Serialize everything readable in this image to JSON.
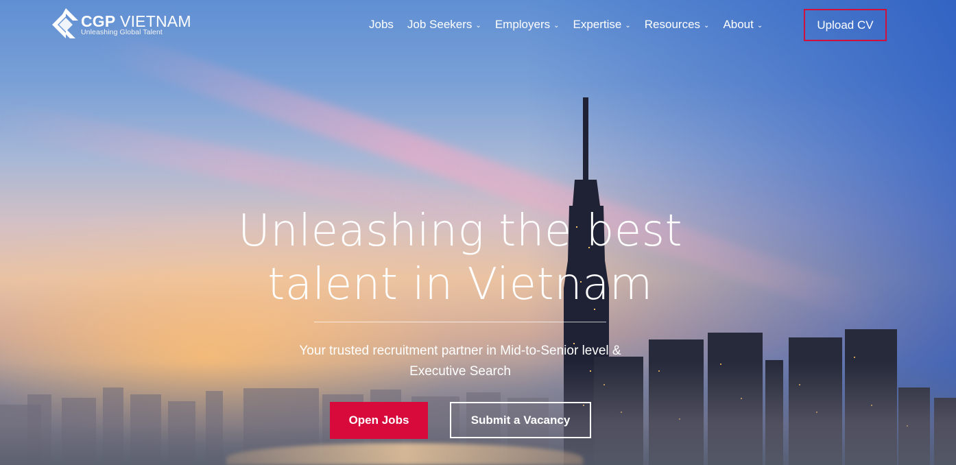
{
  "brand": {
    "name_bold": "CGP",
    "name_light": " VIETNAM",
    "tagline": "Unleashing Global Talent",
    "logo_icon": "diamond-arrow-logo"
  },
  "nav": {
    "items": [
      {
        "label": "Jobs",
        "has_dropdown": false
      },
      {
        "label": "Job Seekers",
        "has_dropdown": true
      },
      {
        "label": "Employers",
        "has_dropdown": true
      },
      {
        "label": "Expertise",
        "has_dropdown": true
      },
      {
        "label": "Resources",
        "has_dropdown": true
      },
      {
        "label": "About",
        "has_dropdown": true
      }
    ],
    "dropdown_glyph": "⌄",
    "upload_cv": "Upload CV"
  },
  "hero": {
    "headline_line1": "Unleashing the best",
    "headline_line2": "talent in Vietnam",
    "subtitle_line1": "Your trusted recruitment partner in Mid-to-Senior level &",
    "subtitle_line2": "Executive Search",
    "primary_cta": "Open Jobs",
    "secondary_cta": "Submit a Vacancy"
  },
  "colors": {
    "accent_red": "#d70a3b",
    "upload_border": "#d0103a",
    "text": "#ffffff"
  }
}
